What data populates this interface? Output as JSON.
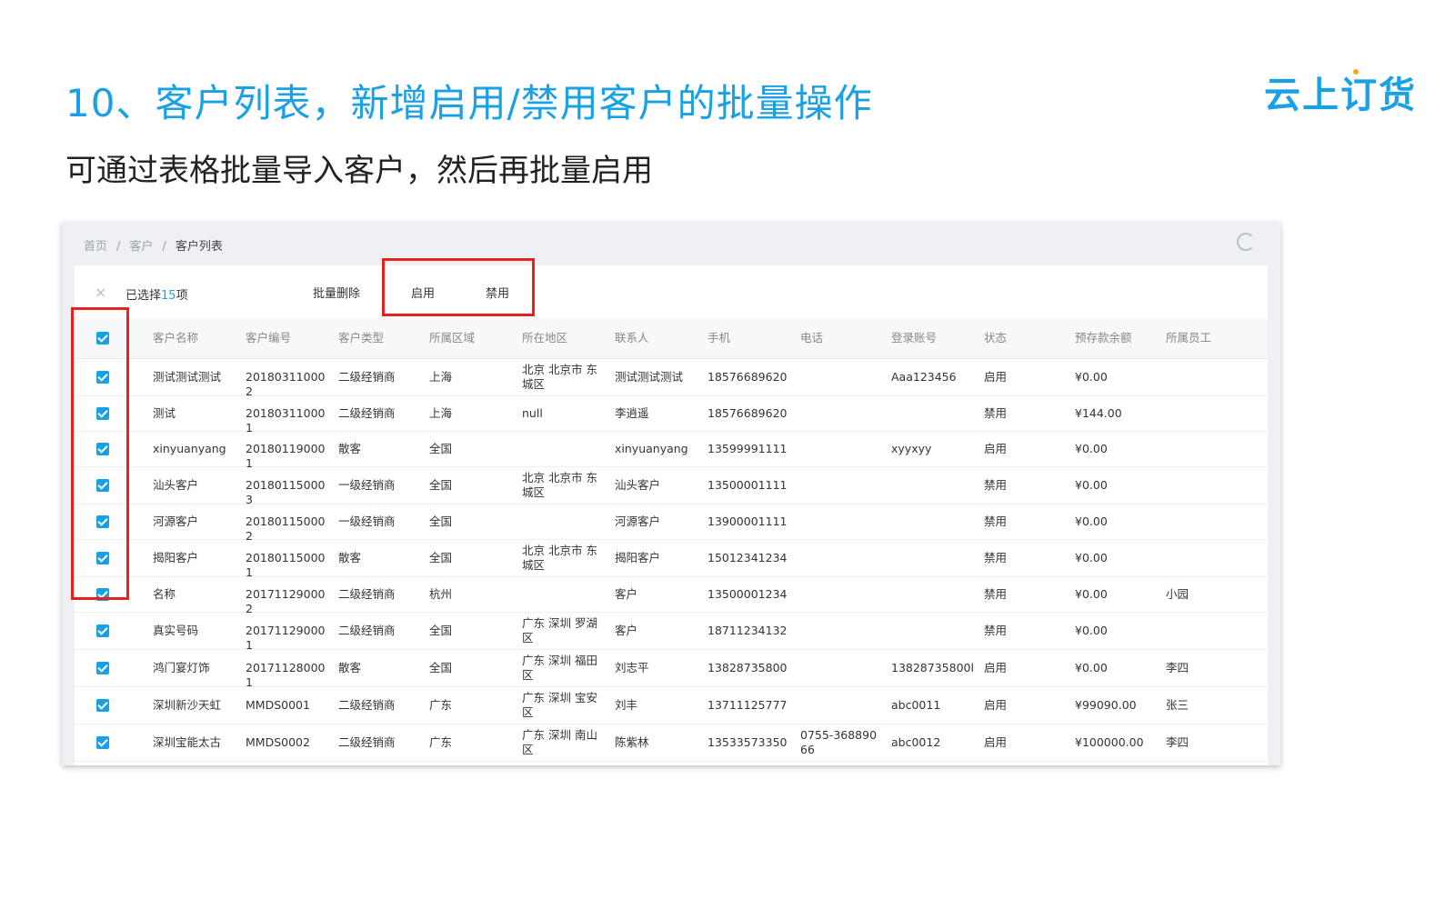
{
  "title": "10、客户列表，新增启用/禁用客户的批量操作",
  "subtitle": "可通过表格批量导入客户，然后再批量启用",
  "logo": "云上订货",
  "breadcrumb": [
    "首页",
    "客户",
    "客户列表"
  ],
  "actions": {
    "close": "×",
    "selected_prefix": "已选择",
    "selected_count": "15",
    "selected_suffix": "项",
    "batch_delete": "批量删除",
    "enable": "启用",
    "disable": "禁用"
  },
  "columns": [
    "客户名称",
    "客户编号",
    "客户类型",
    "所属区域",
    "所在地区",
    "联系人",
    "手机",
    "电话",
    "登录账号",
    "状态",
    "预存款余额",
    "所属员工"
  ],
  "rows": [
    {
      "name": "测试测试测试",
      "code": "201803110002",
      "type": "二级经销商",
      "area": "上海",
      "region": "北京 北京市 东城区",
      "contact": "测试测试测试",
      "mobile": "18576689620",
      "phone": "",
      "account": "Aaa123456",
      "status": "启用",
      "balance": "¥0.00",
      "staff": ""
    },
    {
      "name": "测试",
      "code": "201803110001",
      "type": "二级经销商",
      "area": "上海",
      "region": "null",
      "contact": "李逍遥",
      "mobile": "18576689620",
      "phone": "",
      "account": "",
      "status": "禁用",
      "balance": "¥144.00",
      "staff": ""
    },
    {
      "name": "xinyuanyang",
      "code": "201801190001",
      "type": "散客",
      "area": "全国",
      "region": "",
      "contact": "xinyuanyang",
      "mobile": "13599991111",
      "phone": "",
      "account": "xyyxyy",
      "status": "启用",
      "balance": "¥0.00",
      "staff": ""
    },
    {
      "name": "汕头客户",
      "code": "201801150003",
      "type": "一级经销商",
      "area": "全国",
      "region": "北京 北京市 东城区",
      "contact": "汕头客户",
      "mobile": "13500001111",
      "phone": "",
      "account": "",
      "status": "禁用",
      "balance": "¥0.00",
      "staff": ""
    },
    {
      "name": "河源客户",
      "code": "201801150002",
      "type": "一级经销商",
      "area": "全国",
      "region": "",
      "contact": "河源客户",
      "mobile": "13900001111",
      "phone": "",
      "account": "",
      "status": "禁用",
      "balance": "¥0.00",
      "staff": ""
    },
    {
      "name": "揭阳客户",
      "code": "201801150001",
      "type": "散客",
      "area": "全国",
      "region": "北京 北京市 东城区",
      "contact": "揭阳客户",
      "mobile": "15012341234",
      "phone": "",
      "account": "",
      "status": "禁用",
      "balance": "¥0.00",
      "staff": ""
    },
    {
      "name": "名称",
      "code": "201711290002",
      "type": "二级经销商",
      "area": "杭州",
      "region": "",
      "contact": "客户",
      "mobile": "13500001234",
      "phone": "",
      "account": "",
      "status": "禁用",
      "balance": "¥0.00",
      "staff": "小园"
    },
    {
      "name": "真实号码",
      "code": "201711290001",
      "type": "二级经销商",
      "area": "全国",
      "region": "广东 深圳 罗湖区",
      "contact": "客户",
      "mobile": "18711234132",
      "phone": "",
      "account": "",
      "status": "禁用",
      "balance": "¥0.00",
      "staff": ""
    },
    {
      "name": "鸿门宴灯饰",
      "code": "201711280001",
      "type": "散客",
      "area": "全国",
      "region": "广东 深圳 福田区",
      "contact": "刘志平",
      "mobile": "13828735800",
      "phone": "",
      "account": "13828735800l",
      "status": "启用",
      "balance": "¥0.00",
      "staff": "李四"
    },
    {
      "name": "深圳新沙天虹",
      "code": "MMDS0001",
      "type": "二级经销商",
      "area": "广东",
      "region": "广东 深圳 宝安区",
      "contact": "刘丰",
      "mobile": "13711125777",
      "phone": "",
      "account": "abc0011",
      "status": "启用",
      "balance": "¥99090.00",
      "staff": "张三"
    },
    {
      "name": "深圳宝能太古",
      "code": "MMDS0002",
      "type": "二级经销商",
      "area": "广东",
      "region": "广东 深圳 南山区",
      "contact": "陈紫林",
      "mobile": "13533573350",
      "phone": "0755-36889066",
      "account": "abc0012",
      "status": "启用",
      "balance": "¥100000.00",
      "staff": "李四"
    }
  ],
  "colors": {
    "accent": "#1aa1e5",
    "highlight": "#e52222",
    "logo_dot": "#f5a623"
  }
}
